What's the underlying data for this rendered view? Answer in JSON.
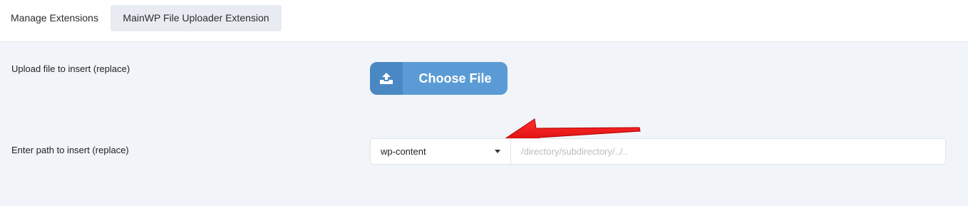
{
  "tabs": {
    "manage_label": "Manage Extensions",
    "uploader_label": "MainWP File Uploader Extension"
  },
  "upload": {
    "label": "Upload file to insert (replace)",
    "button_label": "Choose File",
    "button_icon": "upload-icon"
  },
  "path": {
    "label": "Enter path to insert (replace)",
    "select_value": "wp-content",
    "input_placeholder": "/directory/subdirectory/../..",
    "input_value": ""
  },
  "colors": {
    "button_bg": "#5b9bd5",
    "button_icon_bg": "#4a88c4",
    "annotation_arrow": "#ee1111",
    "content_bg": "#f1f4f8",
    "active_tab_bg": "#e8ecf2"
  }
}
